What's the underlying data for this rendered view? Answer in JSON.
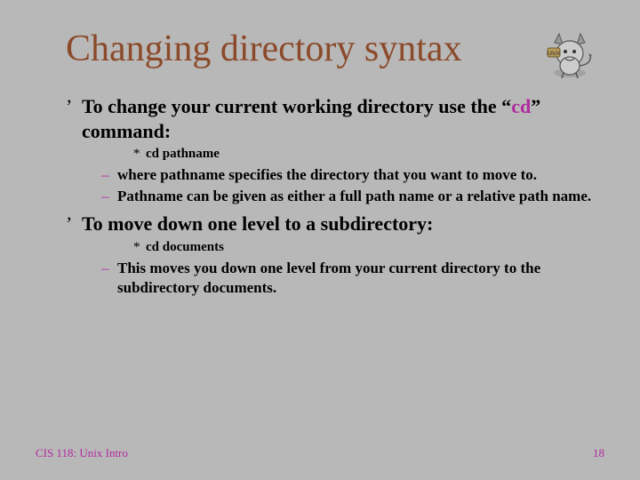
{
  "title": "Changing directory syntax",
  "mascot_alt": "BSD daemon mascot",
  "point1": {
    "prefix": "To change your current working directory use the “",
    "cmd": "cd",
    "suffix": "” command:",
    "example": "cd pathname",
    "sub1": "where pathname specifies the directory that you want to move to.",
    "sub2": "Pathname can be given as either a full path name or a relative path name."
  },
  "point2": {
    "text": "To move down one level to a subdirectory:",
    "example": "cd documents",
    "sub1": "This moves you down one level from your current directory to the subdirectory documents."
  },
  "footer_left": "CIS 118: Unix Intro",
  "footer_right": "18"
}
